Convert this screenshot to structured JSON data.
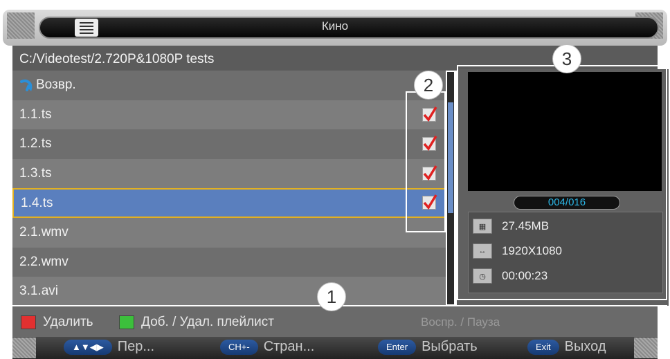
{
  "title": "Кино",
  "path": "C:/Videotest/2.720P&1080P tests",
  "list": {
    "back_label": "Возвр.",
    "items": [
      {
        "name": "1.1.ts",
        "checked": true
      },
      {
        "name": "1.2.ts",
        "checked": true
      },
      {
        "name": "1.3.ts",
        "checked": true
      },
      {
        "name": "1.4.ts",
        "checked": true,
        "selected": true
      },
      {
        "name": "2.1.wmv",
        "checked": false
      },
      {
        "name": "2.2.wmv",
        "checked": false
      },
      {
        "name": "3.1.avi",
        "checked": false
      }
    ]
  },
  "preview": {
    "counter": "004/016",
    "size": "27.45MB",
    "resolution": "1920X1080",
    "duration": "00:00:23"
  },
  "legend": {
    "red_label": "Удалить",
    "green_label": "Доб. / Удал. плейлист",
    "play_pause_label": "Воспр. / Пауза",
    "red_color": "#e23030",
    "green_color": "#3cbf3c"
  },
  "keys": {
    "nav_key": "▲▼◀▶",
    "nav_label": "Пер...",
    "ch_key": "CH+-",
    "ch_label": "Стран...",
    "enter_key": "Enter",
    "enter_label": "Выбрать",
    "exit_key": "Exit",
    "exit_label": "Выход"
  },
  "callouts": {
    "one": "1",
    "two": "2",
    "three": "3"
  }
}
